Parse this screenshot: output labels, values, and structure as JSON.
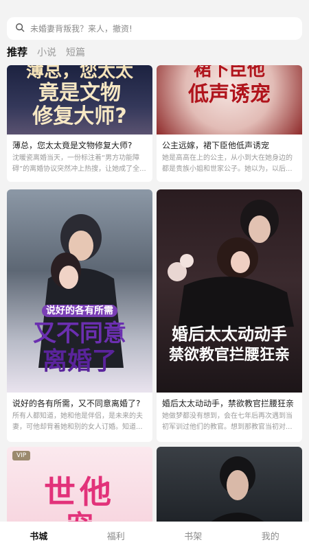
{
  "search": {
    "placeholder": "未婚妻背叛我？来人，撤资!"
  },
  "tabs": [
    {
      "label": "推荐"
    },
    {
      "label": "小说"
    },
    {
      "label": "短篇"
    }
  ],
  "books": [
    {
      "title": "薄总，您太太竟是文物修复大师?",
      "desc": "沈暖瓷离婚当天，一份标注着“男方功能障碍”的离婚协议突然冲上热搜，让她成了全...",
      "cover_lines": [
        "薄总，您太太",
        "竟是文物",
        "修复大师?"
      ]
    },
    {
      "title": "公主远嫁，裙下臣他低声诱宠",
      "desc": "她是高高在上的公主，从小到大在她身边的都是贵族小姐和世家公子。她以为，以后...",
      "cover_lines": [
        "裙下臣他",
        "低声诱宠"
      ]
    },
    {
      "title": "说好的各有所需，又不同意离婚了?",
      "desc": "所有人都知道，她和他是伴侣，是未来的夫妻，可他却背着她和别的女人订婚。知道...",
      "cover_lines": [
        "说好的各有所需",
        "又不同意",
        "离婚了"
      ]
    },
    {
      "title": "婚后太太动动手，禁欲教官拦腰狂亲",
      "desc": "她做梦都没有想到，会在七年后再次遇到当初军训过他们的教官。想到那教官当初对...",
      "cover_lines": [
        "婚后太太动动手",
        "禁欲教官拦腰狂亲"
      ]
    },
    {
      "vip": "VIP",
      "cover_lines": [
        "世他",
        "宠"
      ]
    },
    {
      "cover_lines": []
    }
  ],
  "bottom_nav": [
    {
      "label": "书城"
    },
    {
      "label": "福利"
    },
    {
      "label": "书架"
    },
    {
      "label": "我的"
    }
  ]
}
